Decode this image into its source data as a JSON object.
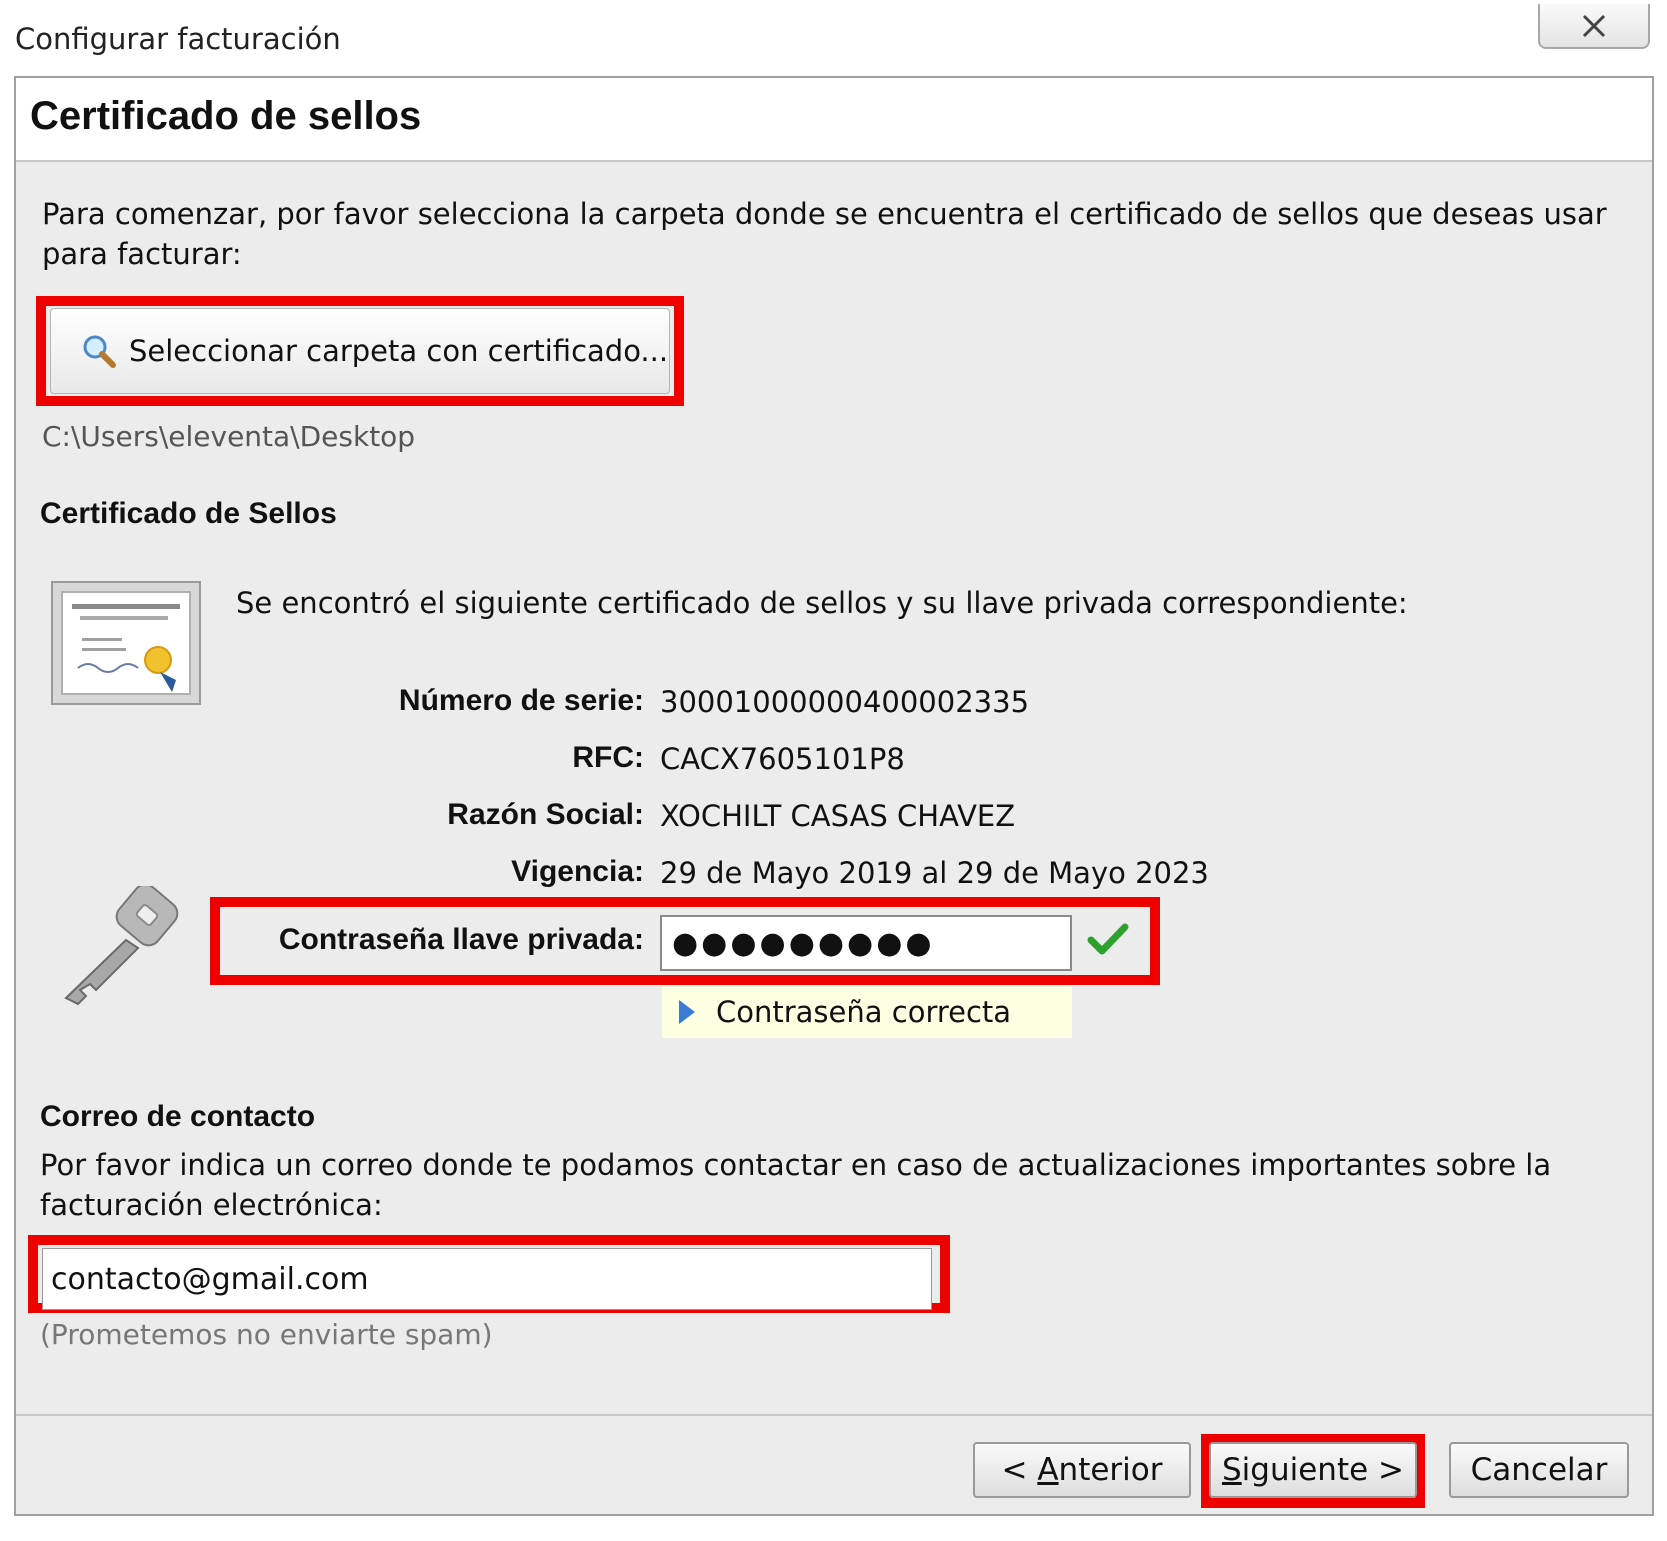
{
  "window": {
    "title": "Configurar facturación",
    "close_icon": "close-icon"
  },
  "header": {
    "title": "Certificado de sellos"
  },
  "intro": "Para comenzar, por favor selecciona la carpeta donde se encuentra el certificado de sellos que deseas usar para facturar:",
  "select_button": {
    "label": "Seleccionar carpeta con certificado...",
    "icon": "magnifier-icon"
  },
  "selected_path": "C:\\Users\\eleventa\\Desktop",
  "certificate": {
    "heading": "Certificado de Sellos",
    "found_text": "Se encontró el siguiente certificado de sellos y su llave privada correspondiente:",
    "fields": [
      {
        "label": "Número de serie:",
        "value": "30001000000400002335"
      },
      {
        "label": "RFC:",
        "value": "CACX7605101P8"
      },
      {
        "label": "Razón Social:",
        "value": "XOCHILT CASAS CHAVEZ"
      },
      {
        "label": "Vigencia:",
        "value": "29 de Mayo 2019 al 29 de Mayo 2023"
      }
    ],
    "password_label": "Contraseña llave privada:",
    "password_value": "●●●●●●●●●",
    "password_hint": "Contraseña correcta"
  },
  "contact": {
    "heading": "Correo de contacto",
    "description": "Por favor indica un correo donde te podamos contactar en caso de actualizaciones importantes sobre la facturación electrónica:",
    "email_value": "contacto@gmail.com",
    "note": "(Prometemos no enviarte spam)"
  },
  "footer": {
    "back_prefix": "< ",
    "back_accel": "A",
    "back_rest": "nterior",
    "next_accel": "S",
    "next_rest": "iguiente >",
    "cancel_label": "Cancelar"
  },
  "colors": {
    "highlight": "#ee0000",
    "check": "#2ea02e",
    "hint_bg": "#ffffe4"
  }
}
